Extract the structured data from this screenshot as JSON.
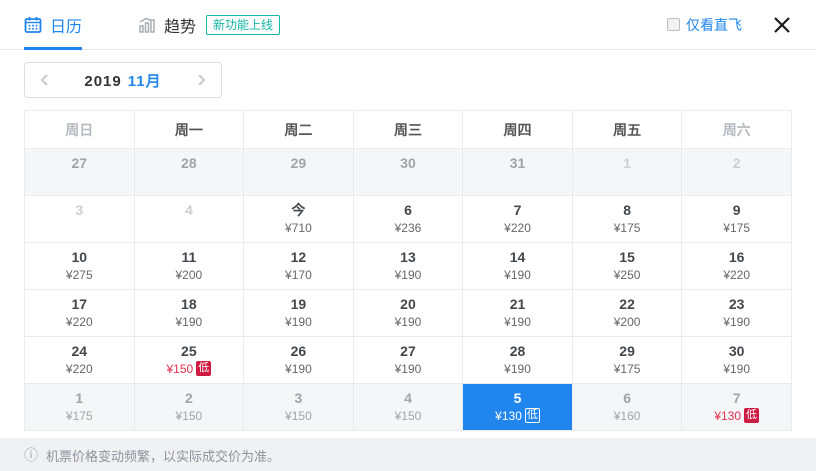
{
  "colors": {
    "accent_blue": "#2086ee",
    "low_price_red": "#e5304e",
    "low_badge_red": "#cf1b41",
    "new_feature_teal": "#12b7a6",
    "shaded_row": "#f5f6f7"
  },
  "tabs": {
    "calendar": "日历",
    "trend": "趋势",
    "badge": "新功能上线"
  },
  "direct_only": "仅看直飞",
  "nav": {
    "year": "2019",
    "month": "11月"
  },
  "calendar": {
    "low_badge": "低",
    "weekdays": [
      {
        "label": "周日",
        "weekend": true
      },
      {
        "label": "周一",
        "weekend": false
      },
      {
        "label": "周二",
        "weekend": false
      },
      {
        "label": "周三",
        "weekend": false
      },
      {
        "label": "周四",
        "weekend": false
      },
      {
        "label": "周五",
        "weekend": false
      },
      {
        "label": "周六",
        "weekend": true
      }
    ],
    "rows": [
      {
        "shaded": true,
        "cells": [
          {
            "day": "27",
            "state": "oct"
          },
          {
            "day": "28",
            "state": "oct"
          },
          {
            "day": "29",
            "state": "oct"
          },
          {
            "day": "30",
            "state": "oct"
          },
          {
            "day": "31",
            "state": "oct"
          },
          {
            "day": "1",
            "state": "faint"
          },
          {
            "day": "2",
            "state": "faint"
          }
        ]
      },
      {
        "shaded": false,
        "cells": [
          {
            "day": "3",
            "state": "faint"
          },
          {
            "day": "4",
            "state": "faint"
          },
          {
            "day": "今",
            "state": "today",
            "price": "¥710"
          },
          {
            "day": "6",
            "state": "normal",
            "price": "¥236"
          },
          {
            "day": "7",
            "state": "normal",
            "price": "¥220"
          },
          {
            "day": "8",
            "state": "normal",
            "price": "¥175"
          },
          {
            "day": "9",
            "state": "normal",
            "price": "¥175"
          }
        ]
      },
      {
        "shaded": false,
        "cells": [
          {
            "day": "10",
            "state": "normal",
            "price": "¥275"
          },
          {
            "day": "11",
            "state": "normal",
            "price": "¥200"
          },
          {
            "day": "12",
            "state": "normal",
            "price": "¥170"
          },
          {
            "day": "13",
            "state": "normal",
            "price": "¥190"
          },
          {
            "day": "14",
            "state": "normal",
            "price": "¥190"
          },
          {
            "day": "15",
            "state": "normal",
            "price": "¥250"
          },
          {
            "day": "16",
            "state": "normal",
            "price": "¥220"
          }
        ]
      },
      {
        "shaded": false,
        "cells": [
          {
            "day": "17",
            "state": "normal",
            "price": "¥220"
          },
          {
            "day": "18",
            "state": "normal",
            "price": "¥190"
          },
          {
            "day": "19",
            "state": "normal",
            "price": "¥190"
          },
          {
            "day": "20",
            "state": "normal",
            "price": "¥190"
          },
          {
            "day": "21",
            "state": "normal",
            "price": "¥190"
          },
          {
            "day": "22",
            "state": "normal",
            "price": "¥200"
          },
          {
            "day": "23",
            "state": "normal",
            "price": "¥190"
          }
        ]
      },
      {
        "shaded": false,
        "cells": [
          {
            "day": "24",
            "state": "normal",
            "price": "¥220"
          },
          {
            "day": "25",
            "state": "low",
            "price": "¥150",
            "low": true
          },
          {
            "day": "26",
            "state": "normal",
            "price": "¥190"
          },
          {
            "day": "27",
            "state": "normal",
            "price": "¥190"
          },
          {
            "day": "28",
            "state": "normal",
            "price": "¥190"
          },
          {
            "day": "29",
            "state": "normal",
            "price": "¥175"
          },
          {
            "day": "30",
            "state": "normal",
            "price": "¥190"
          }
        ]
      },
      {
        "shaded": true,
        "cells": [
          {
            "day": "1",
            "state": "dec",
            "price": "¥175"
          },
          {
            "day": "2",
            "state": "dec",
            "price": "¥150"
          },
          {
            "day": "3",
            "state": "dec",
            "price": "¥150"
          },
          {
            "day": "4",
            "state": "dec",
            "price": "¥150"
          },
          {
            "day": "5",
            "state": "selected",
            "price": "¥130",
            "low": true
          },
          {
            "day": "6",
            "state": "dec",
            "price": "¥160"
          },
          {
            "day": "7",
            "state": "declow",
            "price": "¥130",
            "low": true
          }
        ]
      }
    ]
  },
  "footer": {
    "notice": "机票价格变动频繁，以实际成交价为准。"
  }
}
